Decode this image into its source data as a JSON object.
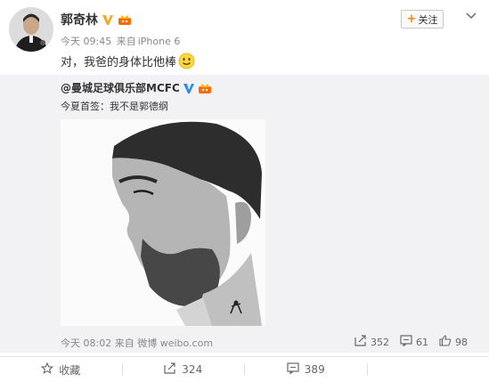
{
  "header": {
    "nickname": "郭奇林",
    "time": "今天 09:45",
    "source_prefix": "来自",
    "source": "iPhone 6",
    "follow_label": "关注"
  },
  "post": {
    "text": "对，我爸的身体比他棒"
  },
  "repost": {
    "author": "@曼城足球俱乐部MCFC",
    "text": "今夏首签：我不是郭德纲",
    "time": "今天 08:02",
    "source_prefix": "来自",
    "source": "微博 weibo.com",
    "reposts": "352",
    "comments": "61",
    "likes": "98"
  },
  "bottom_bar": {
    "favorite_label": "收藏",
    "repost_count": "324",
    "comment_count": "389"
  },
  "colors": {
    "accent": "#ff8200",
    "verified": "#f6a623",
    "repost_bg": "#f2f2f5"
  },
  "icons": {
    "verified": "verified-v-icon",
    "vip": "crown-icon",
    "smile": "smile-emoji-icon",
    "repost": "repost-icon",
    "comment": "comment-icon",
    "like": "thumb-up-icon",
    "favorite": "star-icon",
    "more": "chevron-down-icon"
  }
}
